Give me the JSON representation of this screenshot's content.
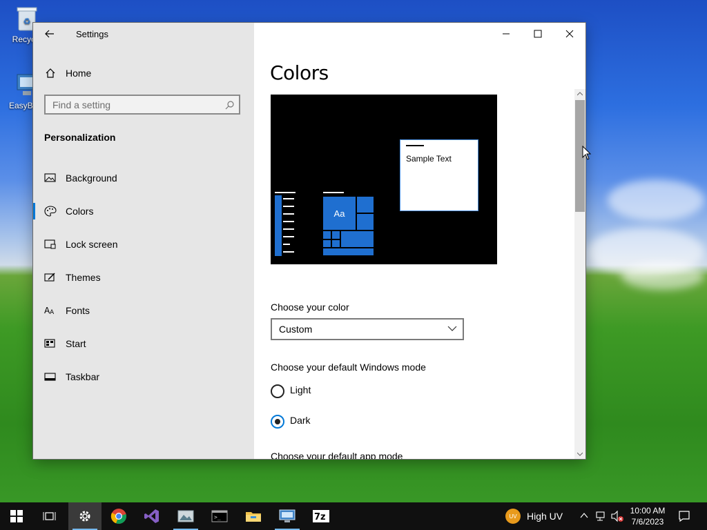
{
  "desktop": {
    "icons": [
      {
        "label": "Recycle"
      },
      {
        "label": "EasyBCD"
      }
    ]
  },
  "window": {
    "title": "Settings"
  },
  "sidebar": {
    "home_label": "Home",
    "search_placeholder": "Find a setting",
    "section_title": "Personalization",
    "items": [
      {
        "label": "Background",
        "icon": "image-icon"
      },
      {
        "label": "Colors",
        "icon": "palette-icon",
        "active": true
      },
      {
        "label": "Lock screen",
        "icon": "lock-screen-icon"
      },
      {
        "label": "Themes",
        "icon": "brush-icon"
      },
      {
        "label": "Fonts",
        "icon": "font-icon"
      },
      {
        "label": "Start",
        "icon": "start-icon"
      },
      {
        "label": "Taskbar",
        "icon": "taskbar-icon"
      }
    ]
  },
  "main": {
    "title": "Colors",
    "preview": {
      "sample_text": "Sample Text",
      "tile_text": "Aa"
    },
    "choose_color_label": "Choose your color",
    "choose_color_value": "Custom",
    "windows_mode_label": "Choose your default Windows mode",
    "windows_mode_options": [
      {
        "label": "Light",
        "selected": false
      },
      {
        "label": "Dark",
        "selected": true
      }
    ],
    "app_mode_label": "Choose your default app mode"
  },
  "taskbar": {
    "weather_badge": "UV",
    "weather_text": "High UV",
    "time": "10:00 AM",
    "date": "7/6/2023",
    "apps": [
      "start",
      "task-view",
      "settings",
      "chrome",
      "visual-studio",
      "image-viewer",
      "terminal",
      "file-explorer",
      "remote-desktop",
      "7zip"
    ]
  },
  "colors": {
    "accent": "#0078d7",
    "tile_blue": "#1f6fd0",
    "sidebar_bg": "#e6e6e6",
    "taskbar_bg": "#101010"
  }
}
